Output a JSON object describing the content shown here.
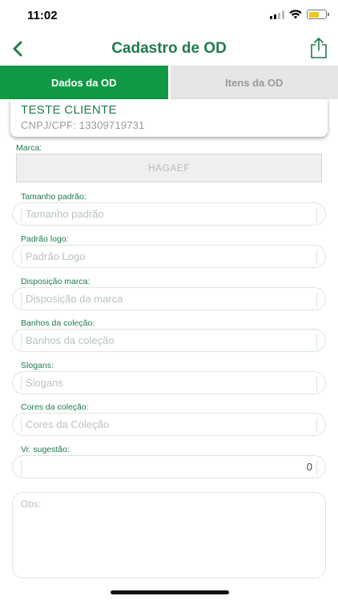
{
  "status_bar": {
    "time": "11:02"
  },
  "nav": {
    "title": "Cadastro de OD"
  },
  "tabs": [
    {
      "label": "Dados da OD",
      "active": true
    },
    {
      "label": "Itens da OD",
      "active": false
    }
  ],
  "client": {
    "name": "TESTE CLIENTE",
    "document": "CNPJ/CPF: 13309719731"
  },
  "form": {
    "marca": {
      "label": "Marca:",
      "value": "HAGAEF"
    },
    "tamanho": {
      "label": "Tamanho padrão:",
      "placeholder": "Tamanho padrão"
    },
    "padrao_logo": {
      "label": "Padrão logo:",
      "placeholder": "Padrão Logo"
    },
    "disposicao": {
      "label": "Disposição marca:",
      "placeholder": "Disposição da marca"
    },
    "banhos": {
      "label": "Banhos da coleção:",
      "placeholder": "Banhos da coleção"
    },
    "slogans": {
      "label": "Slogans:",
      "placeholder": "Slogans"
    },
    "cores": {
      "label": "Cores da coleção:",
      "placeholder": "Cores da Coleção"
    },
    "vr_sugestao": {
      "label": "Vr. sugestão:",
      "placeholder": "0"
    },
    "obs": {
      "placeholder": "Obs:"
    }
  },
  "colors": {
    "accent": "#119a46",
    "title": "#1e7b4a",
    "tab_inactive": "#e6e6e6"
  }
}
